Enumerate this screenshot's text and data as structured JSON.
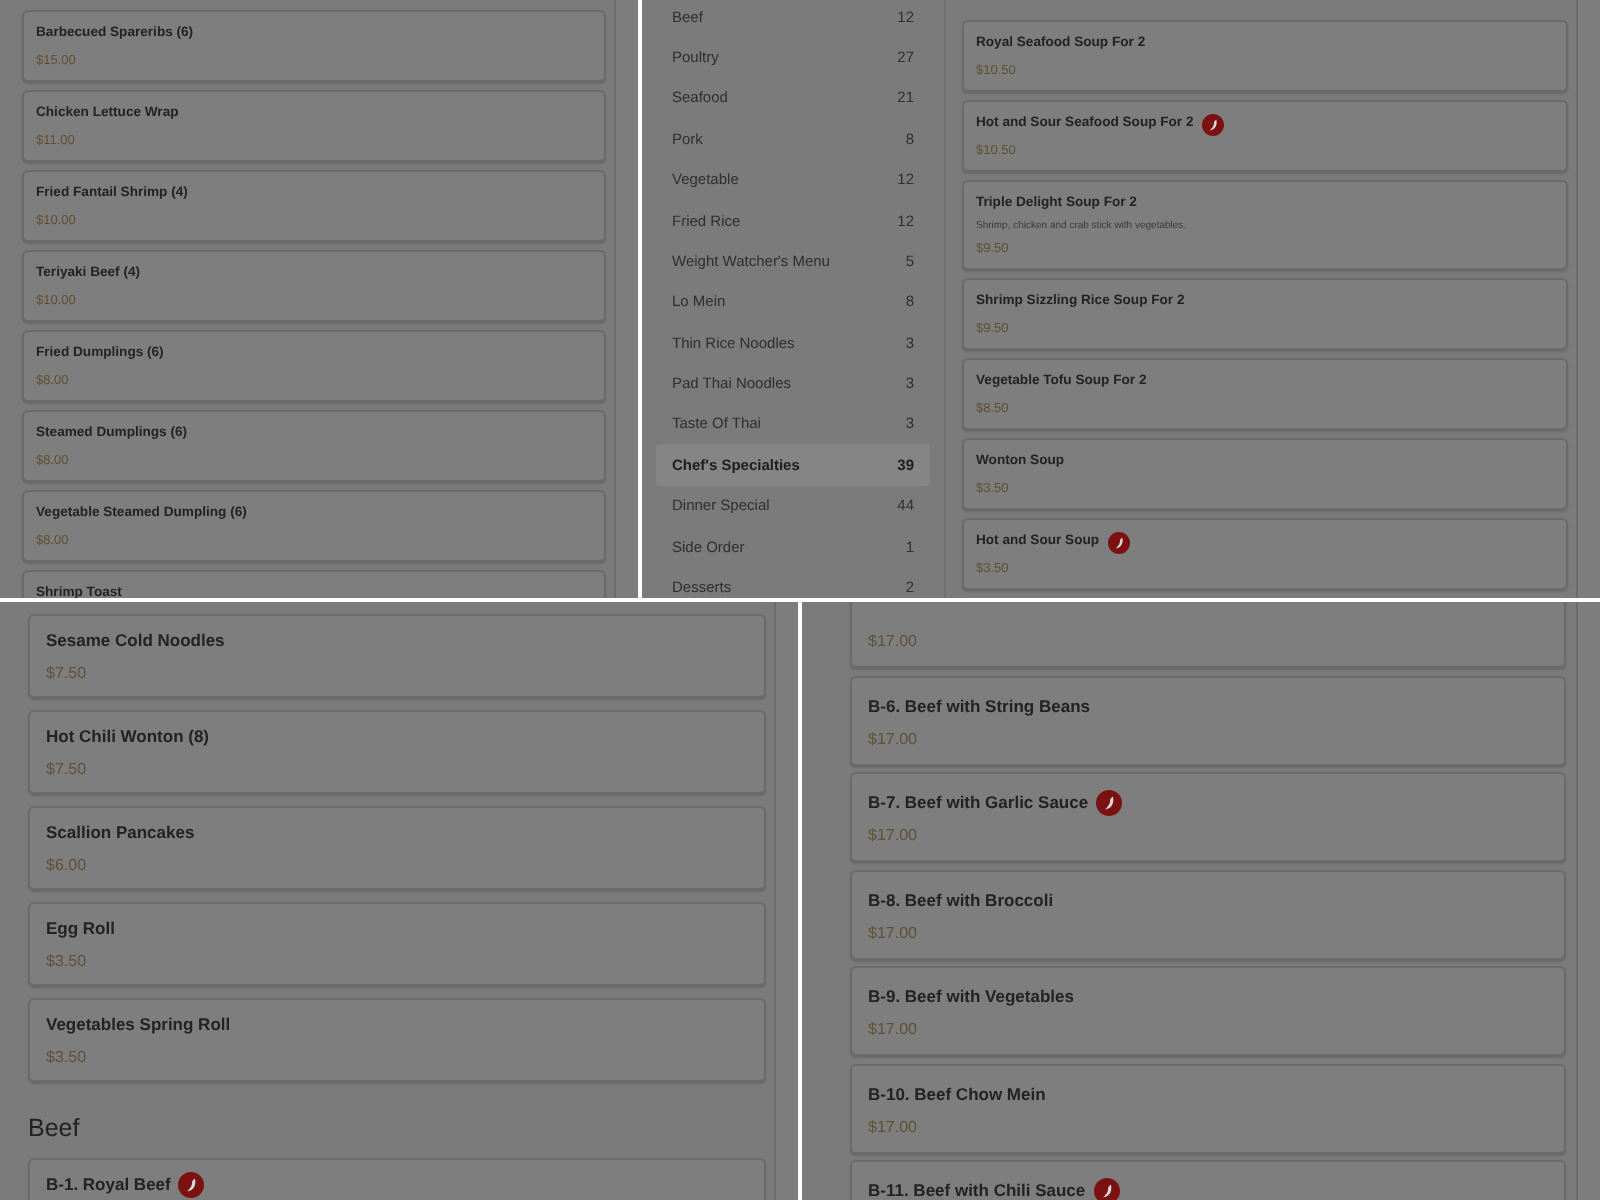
{
  "top_left": {
    "items": [
      {
        "kind": "item",
        "name": "Barbecued Spareribs (6)",
        "price": "$15.00",
        "spicy": false
      },
      {
        "kind": "item",
        "name": "Chicken Lettuce Wrap",
        "price": "$11.00",
        "spicy": false
      },
      {
        "kind": "item",
        "name": "Fried Fantail Shrimp (4)",
        "price": "$10.00",
        "spicy": false
      },
      {
        "kind": "item",
        "name": "Teriyaki Beef (4)",
        "price": "$10.00",
        "spicy": false
      },
      {
        "kind": "item",
        "name": "Fried Dumplings (6)",
        "price": "$8.00",
        "spicy": false
      },
      {
        "kind": "item",
        "name": "Steamed Dumplings (6)",
        "price": "$8.00",
        "spicy": false
      },
      {
        "kind": "item",
        "name": "Vegetable Steamed Dumpling (6)",
        "price": "$8.00",
        "spicy": false
      },
      {
        "kind": "item",
        "name": "Shrimp Toast",
        "spicy": false
      }
    ]
  },
  "top_right": {
    "categories": [
      {
        "label": "Beef",
        "count": "12",
        "selected": false
      },
      {
        "label": "Poultry",
        "count": "27",
        "selected": false
      },
      {
        "label": "Seafood",
        "count": "21",
        "selected": false
      },
      {
        "label": "Pork",
        "count": "8",
        "selected": false
      },
      {
        "label": "Vegetable",
        "count": "12",
        "selected": false
      },
      {
        "label": "Fried Rice",
        "count": "12",
        "selected": false
      },
      {
        "label": "Weight Watcher's Menu",
        "count": "5",
        "selected": false
      },
      {
        "label": "Lo Mein",
        "count": "8",
        "selected": false
      },
      {
        "label": "Thin Rice Noodles",
        "count": "3",
        "selected": false
      },
      {
        "label": "Pad Thai Noodles",
        "count": "3",
        "selected": false
      },
      {
        "label": "Taste Of Thai",
        "count": "3",
        "selected": false
      },
      {
        "label": "Chef's Specialties",
        "count": "39",
        "selected": true
      },
      {
        "label": "Dinner Special",
        "count": "44",
        "selected": false
      },
      {
        "label": "Side Order",
        "count": "1",
        "selected": false
      },
      {
        "label": "Desserts",
        "count": "2",
        "selected": false
      }
    ],
    "items": [
      {
        "kind": "item",
        "name": "Royal Seafood Soup For 2",
        "price": "$10.50",
        "spicy": false
      },
      {
        "kind": "item",
        "name": "Hot and Sour Seafood Soup For 2",
        "price": "$10.50",
        "spicy": true
      },
      {
        "kind": "item",
        "name": "Triple Delight Soup For 2",
        "description": "Shrimp, chicken and crab stick with vegetables.",
        "price": "$9.50",
        "spicy": false
      },
      {
        "kind": "item",
        "name": "Shrimp Sizzling Rice Soup For 2",
        "price": "$9.50",
        "spicy": false
      },
      {
        "kind": "item",
        "name": "Vegetable Tofu Soup For 2",
        "price": "$8.50",
        "spicy": false
      },
      {
        "kind": "item",
        "name": "Wonton Soup",
        "price": "$3.50",
        "spicy": false
      },
      {
        "kind": "item",
        "name": "Hot and Sour Soup",
        "price": "$3.50",
        "spicy": true
      }
    ]
  },
  "bottom_left": {
    "items": [
      {
        "kind": "item",
        "name": "Sesame Cold Noodles",
        "price": "$7.50",
        "spicy": false
      },
      {
        "kind": "item",
        "name": "Hot Chili Wonton (8)",
        "price": "$7.50",
        "spicy": false
      },
      {
        "kind": "item",
        "name": "Scallion Pancakes",
        "price": "$6.00",
        "spicy": false
      },
      {
        "kind": "item",
        "name": "Egg Roll",
        "price": "$3.50",
        "spicy": false
      },
      {
        "kind": "item",
        "name": "Vegetables Spring Roll",
        "price": "$3.50",
        "spicy": false
      },
      {
        "kind": "heading",
        "name": "Beef"
      },
      {
        "kind": "item",
        "name": "B-1. Royal Beef",
        "spicy": true
      }
    ]
  },
  "bottom_right": {
    "items": [
      {
        "kind": "item",
        "price": "$17.00",
        "spicy": false
      },
      {
        "kind": "item",
        "name": "B-6. Beef with String Beans",
        "price": "$17.00",
        "spicy": false
      },
      {
        "kind": "item",
        "name": "B-7. Beef with Garlic Sauce",
        "price": "$17.00",
        "spicy": true
      },
      {
        "kind": "item",
        "name": "B-8. Beef with Broccoli",
        "price": "$17.00",
        "spicy": false
      },
      {
        "kind": "item",
        "name": "B-9. Beef with Vegetables",
        "price": "$17.00",
        "spicy": false
      },
      {
        "kind": "item",
        "name": "B-10. Beef Chow Mein",
        "price": "$17.00",
        "spicy": false
      },
      {
        "kind": "item",
        "name": "B-11. Beef with Chili Sauce",
        "spicy": true
      }
    ]
  }
}
